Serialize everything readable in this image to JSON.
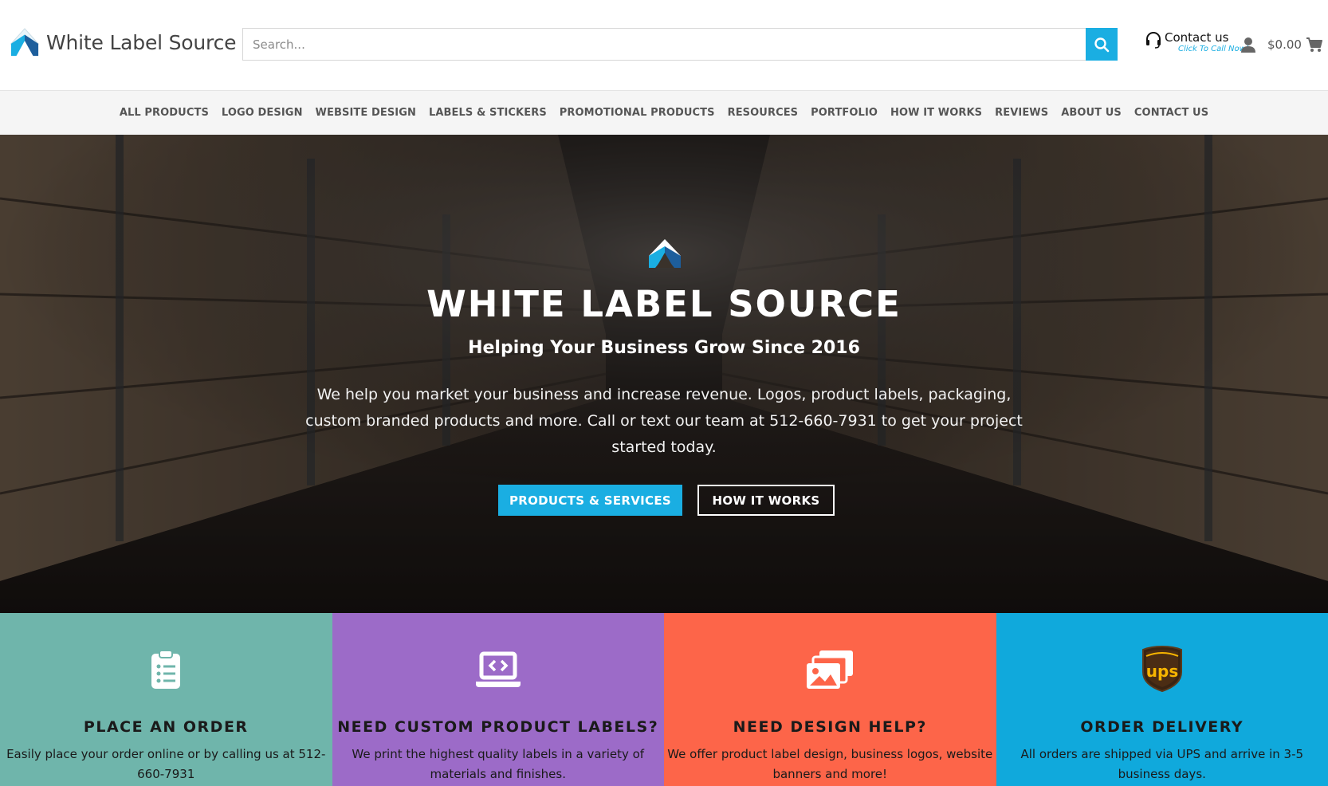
{
  "header": {
    "logo_text": "White Label Source",
    "search_placeholder": "Search...",
    "contact_title": "Contact us",
    "contact_subtitle": "Click To Call Now!",
    "cart_total": "$0.00",
    "icons": [
      "logo-mark-icon",
      "search-icon",
      "headset-icon",
      "user-icon",
      "cart-icon"
    ]
  },
  "nav": {
    "items": [
      {
        "label": "ALL PRODUCTS"
      },
      {
        "label": "LOGO DESIGN"
      },
      {
        "label": "WEBSITE DESIGN"
      },
      {
        "label": "LABELS & STICKERS"
      },
      {
        "label": "PROMOTIONAL PRODUCTS"
      },
      {
        "label": "RESOURCES"
      },
      {
        "label": "PORTFOLIO"
      },
      {
        "label": "HOW IT WORKS"
      },
      {
        "label": "REVIEWS"
      },
      {
        "label": "ABOUT US"
      },
      {
        "label": "CONTACT US"
      }
    ]
  },
  "hero": {
    "title": "WHITE LABEL SOURCE",
    "subtitle": "Helping Your Business Grow Since 2016",
    "description": "We help you market your business and increase revenue. Logos, product labels, packaging, custom branded products and more. Call or text our team at 512-660-7931 to get your project started today.",
    "primary_button": "PRODUCTS & SERVICES",
    "secondary_button": "HOW IT WORKS"
  },
  "features": [
    {
      "title": "PLACE AN ORDER",
      "text": "Easily place your order online or by calling us at 512-660-7931",
      "icon": "clipboard-list-icon",
      "color": "#6fb5ab"
    },
    {
      "title": "NEED CUSTOM PRODUCT LABELS?",
      "text": "We print the highest quality labels in a variety of materials and finishes.",
      "icon": "laptop-code-icon",
      "color": "#9c6bc8"
    },
    {
      "title": "NEED DESIGN HELP?",
      "text": "We offer product label design, business logos, website banners and more!",
      "icon": "images-icon",
      "color": "#fd6549"
    },
    {
      "title": "ORDER DELIVERY",
      "text": "All orders are shipped via UPS and arrive in 3-5 business days.",
      "icon": "ups-shield-icon",
      "color": "#10a9dc"
    }
  ],
  "colors": {
    "accent": "#1aaee2",
    "nav_bg": "#f5f5f5",
    "nav_text": "#555555"
  }
}
